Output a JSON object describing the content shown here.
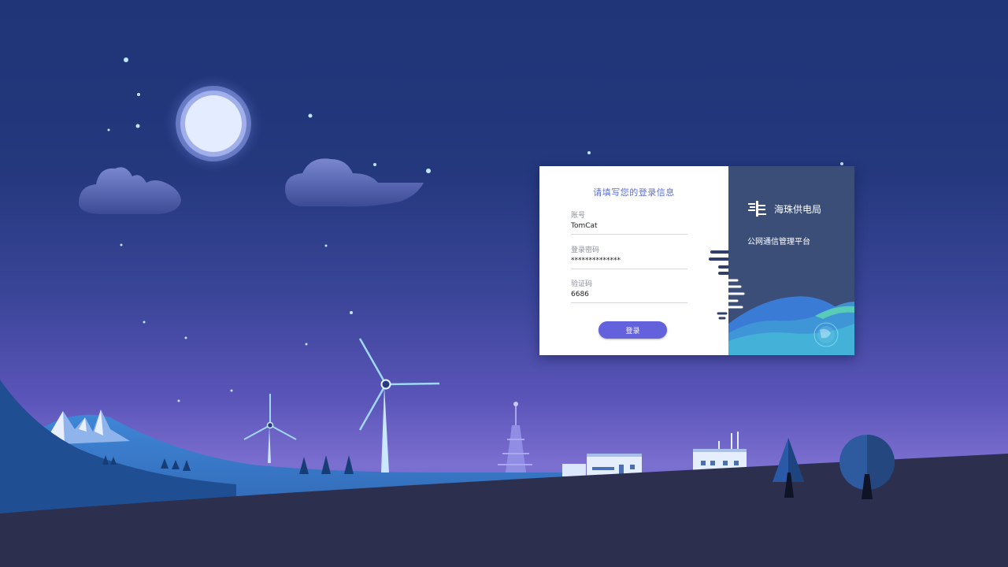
{
  "login_form": {
    "title": "请填写您的登录信息",
    "account": {
      "label": "账号",
      "value": "TomCat"
    },
    "password": {
      "label": "登录密码",
      "value": "**************"
    },
    "captcha": {
      "label": "验证码",
      "value": "6686"
    },
    "submit_label": "登录"
  },
  "brand": {
    "org_name": "海珠供电局",
    "platform_name": "公网通信管理平台"
  },
  "colors": {
    "sky_top": "#1f3577",
    "sky_bottom": "#7b6fd0",
    "accent": "#6461dc",
    "title_text": "#5b6fd6",
    "panel_right": "#3a4e78",
    "ground": "#2d2f4e"
  }
}
